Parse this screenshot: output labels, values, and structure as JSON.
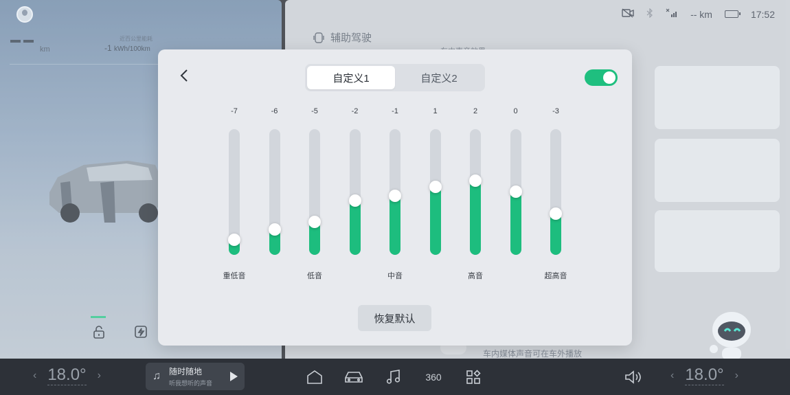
{
  "left_panel": {
    "range_value": "— —",
    "range_unit": "km",
    "consumption_label": "近百公里能耗",
    "consumption_value": "-1",
    "consumption_unit": "kWh/100km"
  },
  "status_bar": {
    "range": "-- km",
    "time": "17:52"
  },
  "right_panel": {
    "assist_title": "辅助驾驶",
    "assist_sub": "车内声音效果",
    "outside_note": "车内媒体声音可在车外播放"
  },
  "modal": {
    "tabs": [
      {
        "label": "自定义1",
        "active": true
      },
      {
        "label": "自定义2",
        "active": false
      }
    ],
    "toggle_on": true,
    "bands": [
      {
        "value": -7,
        "level": 0.12
      },
      {
        "value": -6,
        "level": 0.2
      },
      {
        "value": -5,
        "level": 0.26
      },
      {
        "value": -2,
        "level": 0.43
      },
      {
        "value": -1,
        "level": 0.47
      },
      {
        "value": 1,
        "level": 0.54
      },
      {
        "value": 2,
        "level": 0.59
      },
      {
        "value": 0,
        "level": 0.5
      },
      {
        "value": -3,
        "level": 0.33
      }
    ],
    "band_labels": [
      "重低音",
      "低音",
      "中音",
      "高音",
      "超高音"
    ],
    "reset_label": "恢复默认",
    "accent_color": "#1dbd7e"
  },
  "dock": {
    "temp_left": "18.0°",
    "temp_right": "18.0°",
    "media_title": "随时随地",
    "media_subtitle": "听我想听的声音",
    "icon_360": "360"
  }
}
